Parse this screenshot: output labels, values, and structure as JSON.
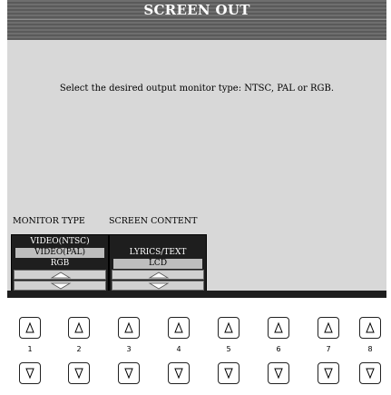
{
  "screen": {
    "title": "SCREEN OUT",
    "message": "Select the desired output monitor type: NTSC, PAL or RGB."
  },
  "monitor_type": {
    "label": "MONITOR TYPE",
    "options": [
      "VIDEO(NTSC)",
      "VIDEO(PAL)",
      "RGB"
    ],
    "selected": "VIDEO(PAL)"
  },
  "screen_content": {
    "label": "SCREEN CONTENT",
    "options": [
      "LYRICS/TEXT",
      "LCD"
    ],
    "selected": "LCD"
  },
  "panel_buttons": {
    "numbers": [
      "1",
      "2",
      "3",
      "4",
      "5",
      "6",
      "7",
      "8"
    ],
    "up_icon": "triangle-up-icon",
    "down_icon": "triangle-down-icon"
  }
}
